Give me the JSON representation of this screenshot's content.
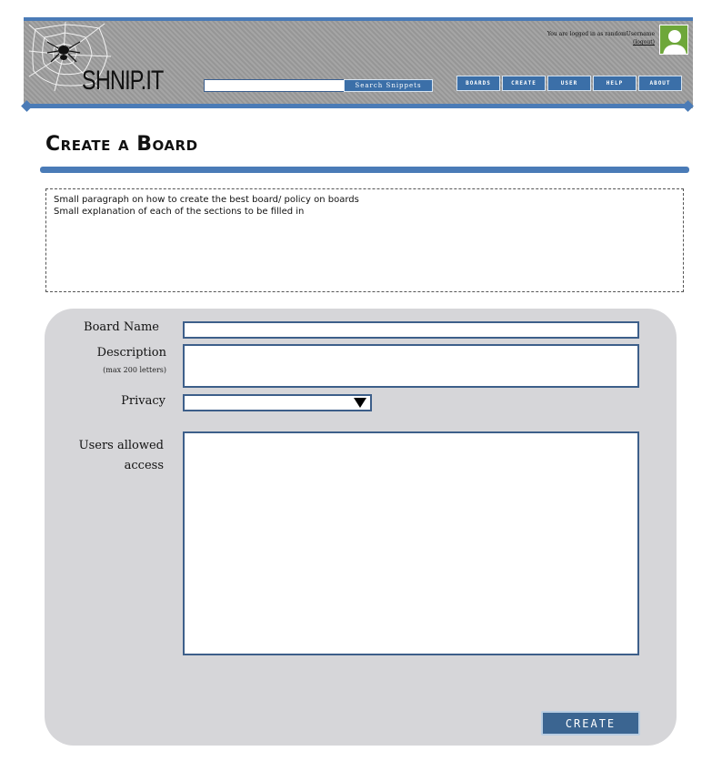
{
  "header": {
    "logo_text": "SHNIP.IT",
    "search": {
      "value": "",
      "button_label": "Search Snippets"
    },
    "nav": [
      "BOARDS",
      "CREATE",
      "USER",
      "HELP",
      "ABOUT"
    ],
    "login_text": "You are logged in as randomUsername",
    "logout_label": "(logout)"
  },
  "page": {
    "title": "Create a Board",
    "info_lines": [
      "Small paragraph on how to create the best board/ policy on boards",
      "Small explanation of each of the sections to be filled in"
    ]
  },
  "form": {
    "board_name_label": "Board Name",
    "board_name_value": "",
    "description_label": "Description",
    "description_hint": "(max 200 letters)",
    "description_value": "",
    "privacy_label": "Privacy",
    "privacy_value": "",
    "users_label_line1": "Users allowed",
    "users_label_line2": "access",
    "users_value": "",
    "submit_label": "CREATE"
  },
  "colors": {
    "accent": "#4a7bb7",
    "nav_button": "#3b6fa8",
    "form_panel": "#d6d6d9",
    "avatar": "#6ea73a"
  },
  "icons": {
    "logo": "spider-web-icon",
    "avatar": "user-avatar-icon",
    "dropdown": "triangle-down-icon"
  }
}
